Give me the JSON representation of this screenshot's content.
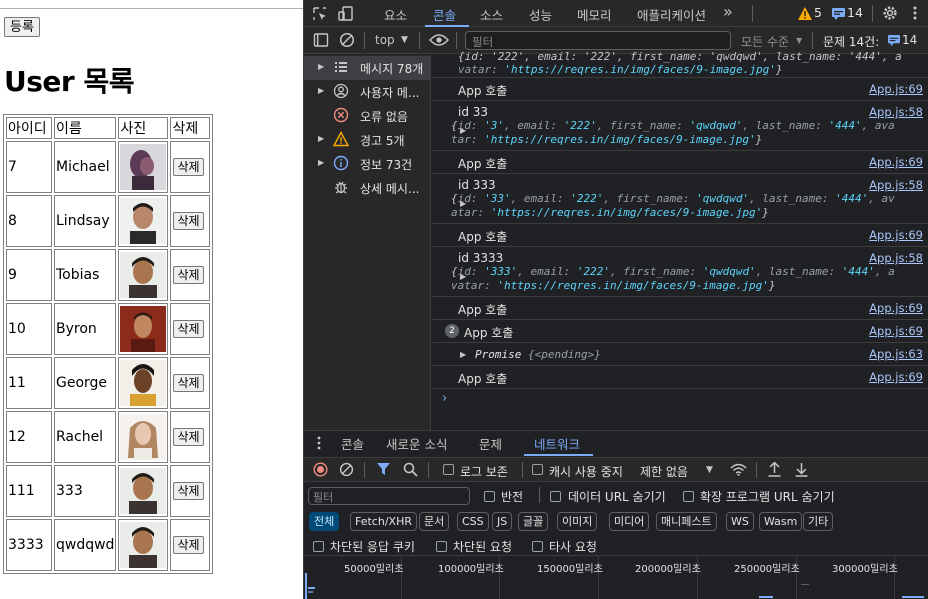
{
  "page": {
    "register_label": "등록",
    "title": "User 목록",
    "columns": [
      "아이디",
      "이름",
      "사진",
      "삭제"
    ],
    "delete_label": "삭제",
    "users": [
      {
        "id": "7",
        "name": "Michael"
      },
      {
        "id": "8",
        "name": "Lindsay"
      },
      {
        "id": "9",
        "name": "Tobias"
      },
      {
        "id": "10",
        "name": "Byron"
      },
      {
        "id": "11",
        "name": "George"
      },
      {
        "id": "12",
        "name": "Rachel"
      },
      {
        "id": "111",
        "name": "333"
      },
      {
        "id": "3333",
        "name": "qwdqwd"
      }
    ]
  },
  "devtools": {
    "tabs": [
      "요소",
      "콘솔",
      "소스",
      "성능",
      "메모리",
      "애플리케이션"
    ],
    "active_tab": "콘솔",
    "more_tabs": "»",
    "warning_count": "5",
    "message_count": "14",
    "context": "top",
    "filter_placeholder": "필터",
    "level": "모든 수준",
    "issues": "문제 14건:",
    "issues_count": "14",
    "sidebar": [
      {
        "label": "메시지 78개",
        "icon": "list-icon",
        "selected": true
      },
      {
        "label": "사용자 메...",
        "icon": "user-icon"
      },
      {
        "label": "오류 없음",
        "icon": "error-icon"
      },
      {
        "label": "경고 5개",
        "icon": "warning-icon"
      },
      {
        "label": "정보 73건",
        "icon": "info-icon"
      },
      {
        "label": "상세 메시...",
        "icon": "bug-icon"
      }
    ],
    "console": {
      "partial_top_line1": "{id: '222', email: '222', first_name: 'qwdqwd', last_name: '444', a",
      "partial_top_line2_key": "vatar: ",
      "partial_top_line2_val": "'https://reqres.in/img/faces/9-image.jpg'",
      "app_call": "App 호출",
      "src69": "App.js:69",
      "src58": "App.js:58",
      "src63": "App.js:63",
      "entries": [
        {
          "label": "id 33",
          "obj_id": "'3'",
          "obj_line2_key": "tar: "
        },
        {
          "label": "id 333",
          "obj_id": "'33'",
          "obj_line2_key": "atar: "
        },
        {
          "label": "id 3333",
          "obj_id": "'333'",
          "obj_line2_key": "vatar: "
        }
      ],
      "obj_email": "'222'",
      "obj_first": "'qwdqwd'",
      "obj_last": "'444'",
      "obj_avatar": "'https://reqres.in/img/faces/9-image.jpg'",
      "repeat_count": "2",
      "promise": "Promise",
      "pending": "{<pending>}"
    },
    "drawer": {
      "tabs": [
        "콘솔",
        "새로운 소식",
        "문제",
        "네트워크"
      ],
      "active": "네트워크",
      "preserve_log": "로그 보존",
      "disable_cache": "캐시 사용 중지",
      "throttle": "제한 없음",
      "filter_placeholder": "필터",
      "invert": "반전",
      "hide_data_urls": "데이터 URL 숨기기",
      "hide_ext_urls": "확장 프로그램 URL 숨기기",
      "chips": [
        "전체",
        "Fetch/XHR",
        "문서",
        "CSS",
        "JS",
        "글꼴",
        "이미지",
        "미디어",
        "매니페스트",
        "WS",
        "Wasm",
        "기타"
      ],
      "blocked_cookies": "차단된 응답 쿠키",
      "blocked_requests": "차단된 요청",
      "third_party": "타사 요청",
      "ticks": [
        "50000밀리초",
        "100000밀리초",
        "150000밀리초",
        "200000밀리초",
        "250000밀리초",
        "300000밀리초"
      ]
    }
  }
}
